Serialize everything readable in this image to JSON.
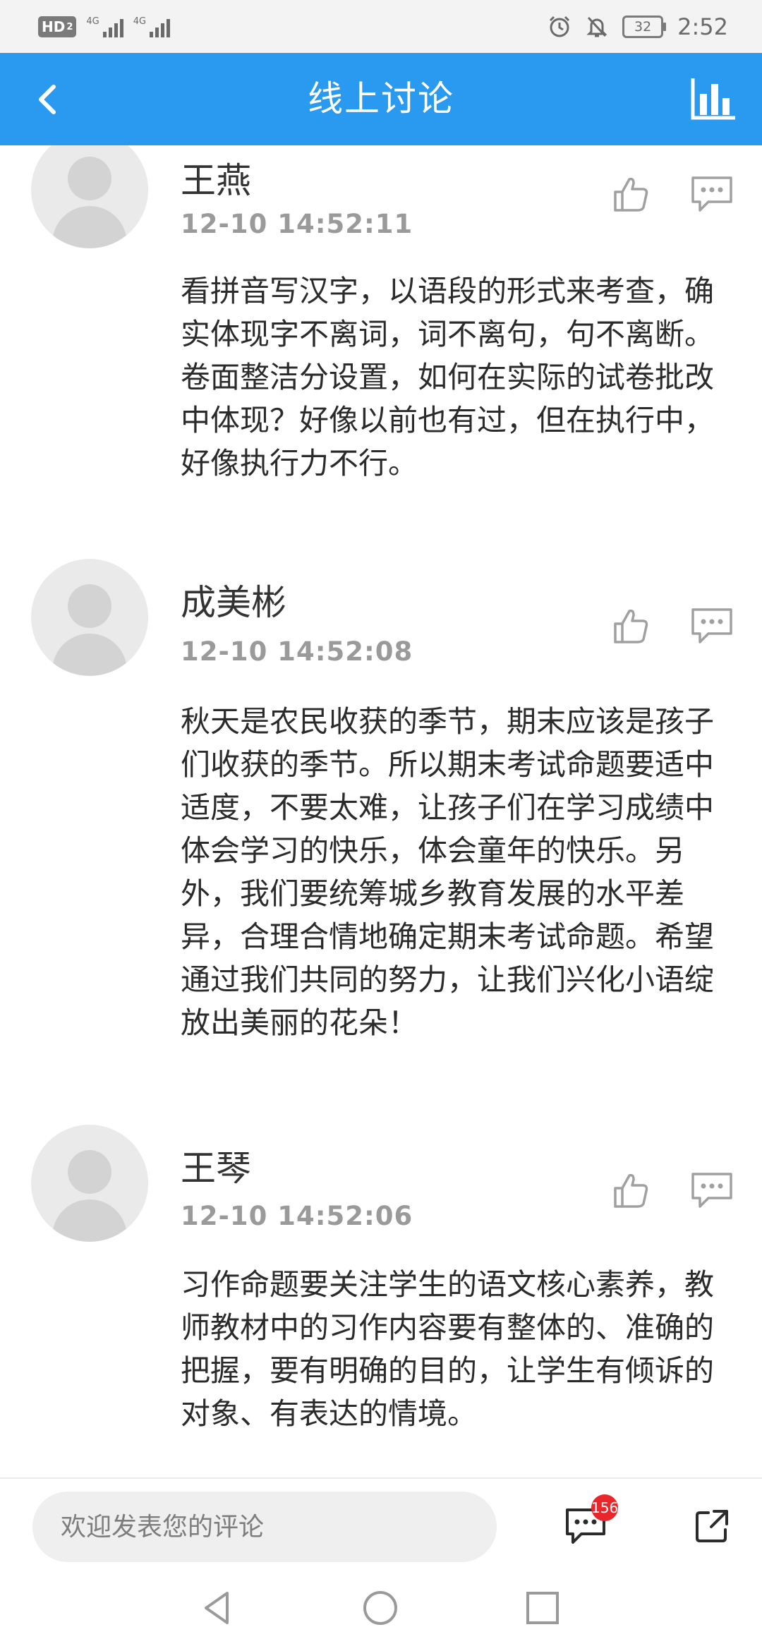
{
  "status_bar": {
    "hd_label": "HD",
    "hd_sub": "2",
    "network_1": "4G",
    "network_2": "4G",
    "battery": "32",
    "time": "2:52"
  },
  "header": {
    "title": "线上讨论"
  },
  "comments": [
    {
      "name": "王燕",
      "time": "12-10 14:52:11",
      "text": "看拼音写汉字，以语段的形式来考查，确实体现字不离词，词不离句，句不离断。卷面整洁分设置，如何在实际的试卷批改中体现？好像以前也有过，但在执行中，好像执行力不行。"
    },
    {
      "name": "成美彬",
      "time": "12-10 14:52:08",
      "text": "秋天是农民收获的季节，期末应该是孩子们收获的季节。所以期末考试命题要适中适度，不要太难，让孩子们在学习成绩中体会学习的快乐，体会童年的快乐。另外，我们要统筹城乡教育发展的水平差异，合理合情地确定期末考试命题。希望通过我们共同的努力，让我们兴化小语绽放出美丽的花朵！"
    },
    {
      "name": "王琴",
      "time": "12-10 14:52:06",
      "text": "习作命题要关注学生的语文核心素养，教师教材中的习作内容要有整体的、准确的把握，要有明确的目的，让学生有倾诉的对象、有表达的情境。"
    }
  ],
  "comment_bar": {
    "placeholder": "欢迎发表您的评论",
    "comment_count": "156"
  },
  "colors": {
    "header_bg": "#2a9af0",
    "badge_bg": "#e8262b"
  }
}
